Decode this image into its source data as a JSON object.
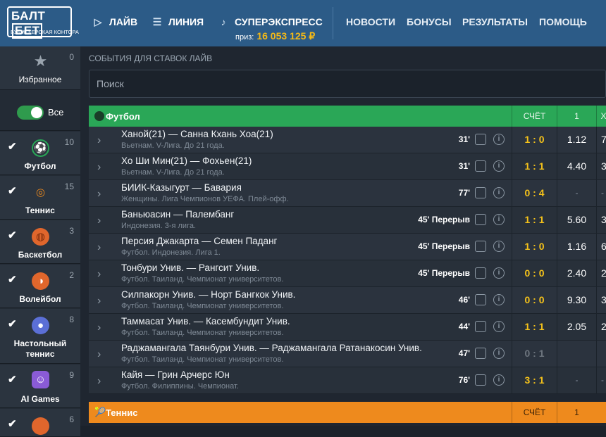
{
  "header": {
    "logo_brand_a": "БАЛТ",
    "logo_brand_b": "БЕТ",
    "logo_sub": "БУКМЕКЕРСКАЯ КОНТОРА",
    "nav": [
      {
        "label": "ЛАЙВ",
        "icon": "play-circle-icon"
      },
      {
        "label": "ЛИНИЯ",
        "icon": "list-icon"
      },
      {
        "label": "СУПЕРЭКСПРЕСС",
        "icon": "guitar-icon"
      }
    ],
    "prize_label": "приз:",
    "prize_value": "16 053 125 ₽",
    "links": [
      "НОВОСТИ",
      "БОНУСЫ",
      "РЕЗУЛЬТАТЫ",
      "ПОМОЩЬ"
    ]
  },
  "sidebar": {
    "favorites": {
      "label": "Избранное",
      "count": "0",
      "icon": "star-icon"
    },
    "all_label": "Все",
    "sports": [
      {
        "label": "Футбол",
        "count": "10",
        "icon": "football-icon",
        "color": "#2aa757"
      },
      {
        "label": "Теннис",
        "count": "15",
        "icon": "tennis-icon",
        "color": "#ee8a1d"
      },
      {
        "label": "Баскетбол",
        "count": "3",
        "icon": "basketball-icon",
        "color": "#e0662c"
      },
      {
        "label": "Волейбол",
        "count": "2",
        "icon": "volleyball-icon",
        "color": "#e0662c"
      },
      {
        "label": "Настольный теннис",
        "count": "8",
        "icon": "table-tennis-icon",
        "color": "#5b6fd6"
      },
      {
        "label": "AI Games",
        "count": "9",
        "icon": "robot-icon",
        "color": "#8a5bd6"
      },
      {
        "label": "",
        "count": "6",
        "icon": "sport-icon",
        "color": "#e0662c"
      }
    ]
  },
  "main": {
    "section_title": "СОБЫТИЯ ДЛЯ СТАВОК ЛАЙВ",
    "search_placeholder": "Поиск",
    "football": {
      "title": "Футбол",
      "col_score": "СЧЁТ",
      "col_1": "1",
      "col_x": "X",
      "events": [
        {
          "teams": "Ханой(21) — Санна Кхань Хоа(21)",
          "league": "Вьетнам. V-Лига. До 21 года.",
          "time": "31'",
          "score": "1 : 0",
          "odd1": "1.12",
          "odd2": "7."
        },
        {
          "teams": "Хо Ши Мин(21) — Фохьен(21)",
          "league": "Вьетнам. V-Лига. До 21 года.",
          "time": "31'",
          "score": "1 : 1",
          "odd1": "4.40",
          "odd2": "3."
        },
        {
          "teams": "БИИК-Казыгурт — Бавария",
          "league": "Женщины. Лига Чемпионов УЕФА. Плей-офф.",
          "time": "77'",
          "score": "0 : 4",
          "odd1": "-",
          "odd2": "-"
        },
        {
          "teams": "Баньюасин — Палембанг",
          "league": "Индонезия. 3-я лига.",
          "time": "45' Перерыв",
          "score": "1 : 1",
          "odd1": "5.60",
          "odd2": "3."
        },
        {
          "teams": "Персия Джакарта — Семен Паданг",
          "league": "Футбол. Индонезия. Лига 1.",
          "time": "45' Перерыв",
          "score": "1 : 0",
          "odd1": "1.16",
          "odd2": "6."
        },
        {
          "teams": "Тонбури Унив. — Рангсит Унив.",
          "league": "Футбол. Таиланд. Чемпионат университетов.",
          "time": "45' Перерыв",
          "score": "0 : 0",
          "odd1": "2.40",
          "odd2": "2."
        },
        {
          "teams": "Силпакорн Унив. — Норт Бангкок Унив.",
          "league": "Футбол. Таиланд. Чемпионат университетов.",
          "time": "46'",
          "score": "0 : 0",
          "odd1": "9.30",
          "odd2": "3."
        },
        {
          "teams": "Таммасат Унив. — Касембундит Унив.",
          "league": "Футбол. Таиланд. Чемпионат университетов.",
          "time": "44'",
          "score": "1 : 1",
          "odd1": "2.05",
          "odd2": "2."
        },
        {
          "teams": "Раджамангала Таянбури Унив. — Раджамангала Ратанакосин Унив.",
          "league": "Футбол. Таиланд. Чемпионат университетов.",
          "time": "47'",
          "score": "0 : 1",
          "odd1": "",
          "odd2": ""
        },
        {
          "teams": "Кайя — Грин Арчерс Юн",
          "league": "Футбол. Филиппины. Чемпионат.",
          "time": "76'",
          "score": "3 : 1",
          "odd1": "-",
          "odd2": "-"
        }
      ]
    },
    "tennis": {
      "title": "Теннис",
      "col_score": "СЧЁТ",
      "col_1": "1"
    }
  }
}
